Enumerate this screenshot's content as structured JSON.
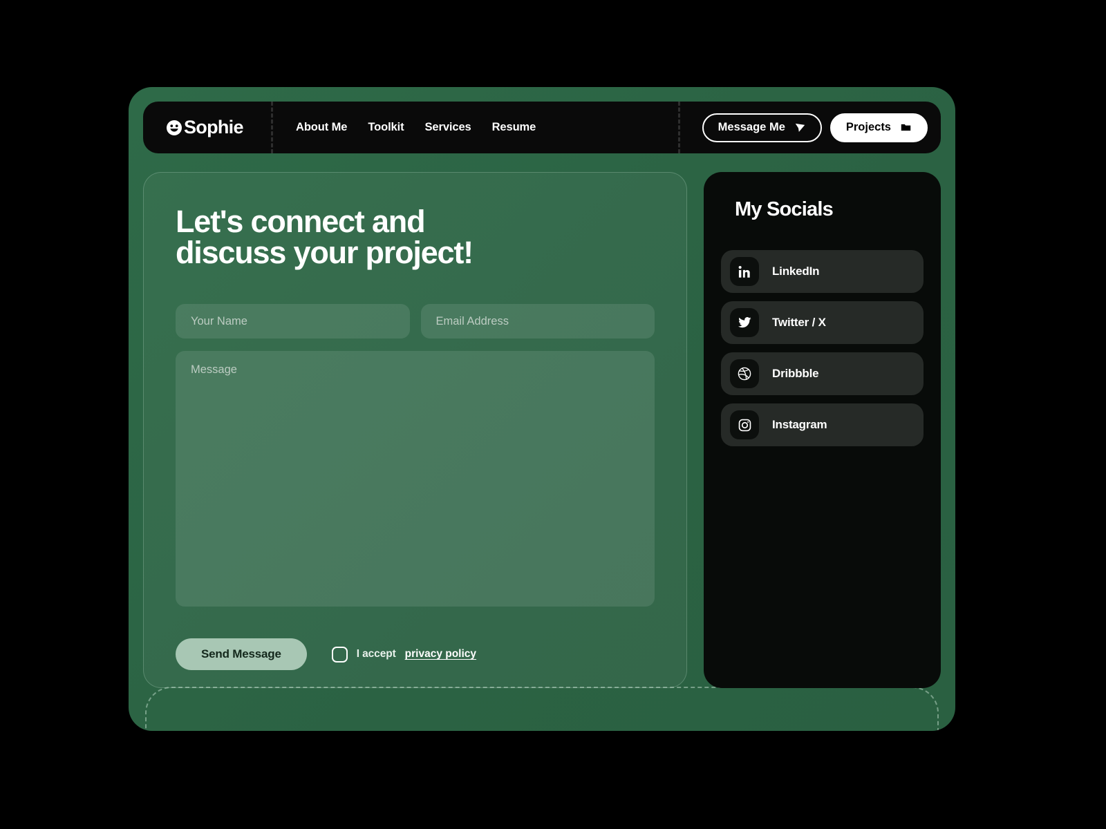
{
  "nav": {
    "brand": {
      "name": "Sophie",
      "icon": "smiley-icon"
    },
    "links": [
      {
        "label": "About Me"
      },
      {
        "label": "Toolkit"
      },
      {
        "label": "Services"
      },
      {
        "label": "Resume"
      }
    ],
    "actions": [
      {
        "label": "Message Me",
        "icon": "send-icon",
        "style": "outline"
      },
      {
        "label": "Projects",
        "icon": "folder-icon",
        "style": "solid"
      }
    ]
  },
  "contact": {
    "headline_line1": "Let's connect and",
    "headline_line2": "discuss your project!",
    "name_field": {
      "value": "",
      "placeholder": "Your Name"
    },
    "email_field": {
      "value": "",
      "placeholder": "Email Address"
    },
    "message_field": {
      "value": "",
      "placeholder": "Message"
    },
    "send_button": "Send Message",
    "accept_text": "I accept",
    "privacy_link": "privacy policy",
    "checkbox_checked": false
  },
  "socials": {
    "title": "My Socials",
    "items": [
      {
        "label": "LinkedIn",
        "icon": "linkedin-icon"
      },
      {
        "label": "Twitter / X",
        "icon": "twitter-icon"
      },
      {
        "label": "Dribbble",
        "icon": "dribbble-icon"
      },
      {
        "label": "Instagram",
        "icon": "instagram-icon"
      }
    ]
  },
  "colors": {
    "page_background": "#000000",
    "frame_green": "#2c6545",
    "nav_black": "#0a0a0a",
    "socials_black": "#080b09",
    "social_item": "#262a27",
    "send_button": "#a8c7b4",
    "accent_white": "#ffffff"
  }
}
